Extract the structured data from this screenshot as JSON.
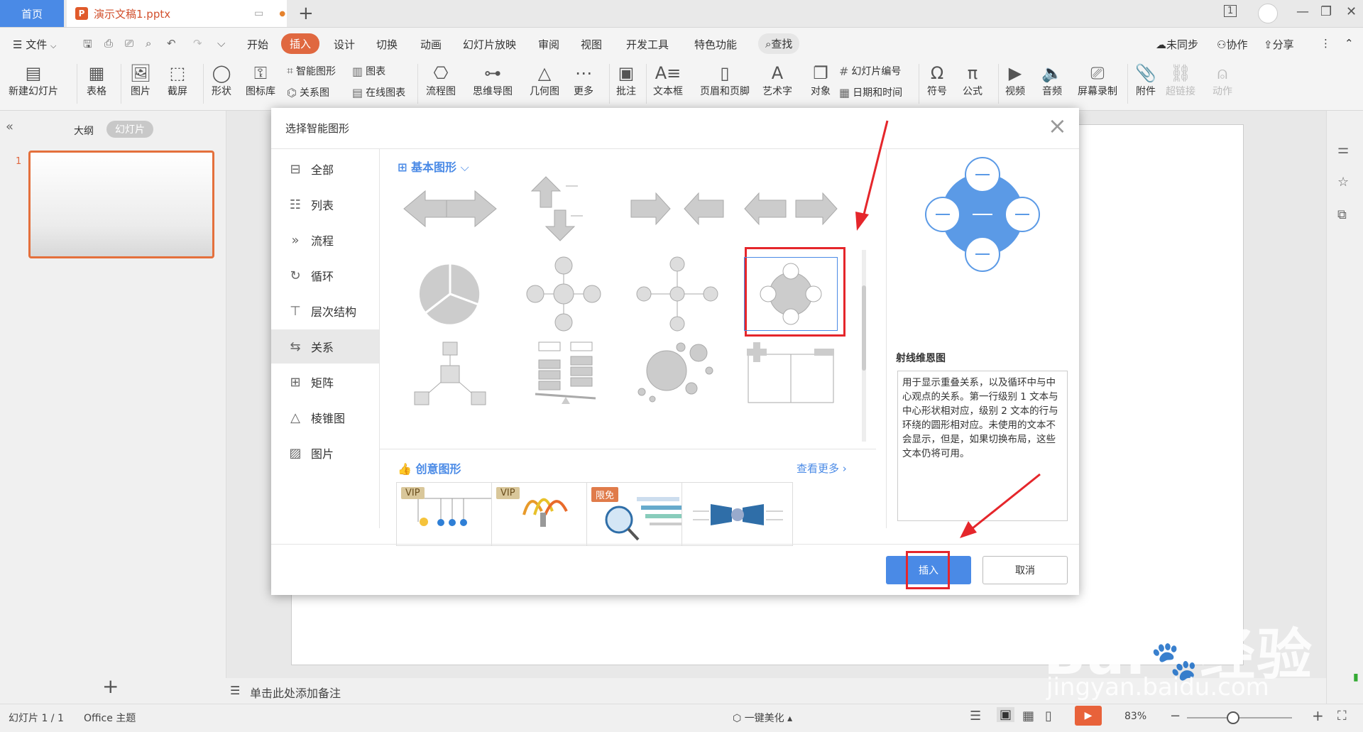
{
  "titlebar": {
    "home_tab": "首页",
    "doc_tab": "演示文稿1.pptx",
    "doc_logo": "P",
    "add_tab": "+",
    "badge_num": "1"
  },
  "menu": {
    "file": "文件",
    "items": [
      "开始",
      "插入",
      "设计",
      "切换",
      "动画",
      "幻灯片放映",
      "审阅",
      "视图",
      "开发工具",
      "特色功能"
    ],
    "search": "查找",
    "sync": "未同步",
    "collab": "协作",
    "share": "分享"
  },
  "ribbon": {
    "new_slide": "新建幻灯片",
    "table": "表格",
    "picture": "图片",
    "screenshot": "截屏",
    "shape": "形状",
    "icon_lib": "图标库",
    "smart_art": "智能图形",
    "chart": "图表",
    "relation": "关系图",
    "online_chart": "在线图表",
    "flowchart": "流程图",
    "mindmap": "思维导图",
    "geometry": "几何图",
    "more": "更多",
    "comment": "批注",
    "textbox": "文本框",
    "header_footer": "页眉和页脚",
    "wordart": "艺术字",
    "object": "对象",
    "slide_num": "幻灯片编号",
    "datetime": "日期和时间",
    "symbol": "符号",
    "formula": "公式",
    "video": "视频",
    "audio": "音频",
    "screen_record": "屏幕录制",
    "attachment": "附件",
    "hyperlink": "超链接",
    "action": "动作"
  },
  "leftpanel": {
    "outline": "大纲",
    "slides": "幻灯片",
    "slide_number": "1",
    "add": "+"
  },
  "notes": {
    "placeholder": "单击此处添加备注"
  },
  "status": {
    "slide_info": "幻灯片 1 / 1",
    "theme": "Office 主题",
    "beautify": "一键美化",
    "zoom": "83%"
  },
  "dialog": {
    "title": "选择智能图形",
    "categories": [
      "全部",
      "列表",
      "流程",
      "循环",
      "层次结构",
      "关系",
      "矩阵",
      "棱锥图",
      "图片"
    ],
    "basic_section": "基本图形",
    "creative_section": "创意图形",
    "see_more": "查看更多",
    "badge_vip": "VIP",
    "badge_free": "限免",
    "preview_title": "射线维恩图",
    "preview_desc": "用于显示重叠关系，以及循环中与中心观点的关系。第一行级别 1 文本与中心形状相对应，级别 2 文本的行与环绕的圆形相对应。未使用的文本不会显示，但是，如果切换布局，这些文本仍将可用。",
    "insert": "插入",
    "cancel": "取消"
  },
  "watermark": {
    "brand": "Bai",
    "brand2": "经验",
    "url": "jingyan.baidu.com"
  },
  "colors": {
    "accent": "#e06840",
    "primary": "#4a8ae6",
    "highlight": "#e5262b"
  }
}
